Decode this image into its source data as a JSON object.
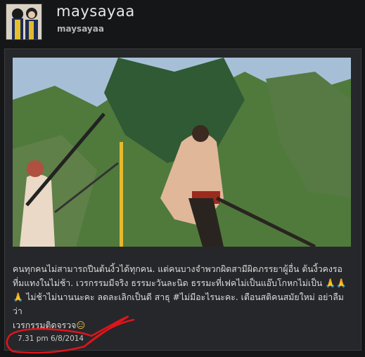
{
  "profile": {
    "display_name": "maysayaa",
    "handle": "maysayaa"
  },
  "post": {
    "caption_lines": [
      "คนทุกคนไม่สามารถปีนต้นงิ้วได้ทุกคน. แต่คนบางจำพวกผิดสามีผิดภรรยาผู้อื่น ต้นงิ้วคงรอ",
      "ที่มแทงในไม่ช้า. เวรกรรมมีจริง ธรรมะวันละนิด ธรรมะที่เฟคไม่เป็นแอ๊บโกหกไม่เป็น",
      "ไม่ช้าไม่นานนะคะ ลดละเลิกเป็นดี สาธุ #ไม่มีอะไรนะคะ. เตือนสติคนสมัยใหม่ อย่าลืมว่า",
      "เวรกรรมติดจรวจ"
    ],
    "emoji_pray": "🙏",
    "emoji_face": "😑",
    "timestamp": "7.31 pm 6/8/2014"
  },
  "icons": {
    "avatar": "profile-avatar",
    "pray": "pray-hands-emoji",
    "face": "expressionless-face-emoji"
  },
  "colors": {
    "background": "#151617",
    "card": "#26272a",
    "annotation": "#e0141b"
  }
}
